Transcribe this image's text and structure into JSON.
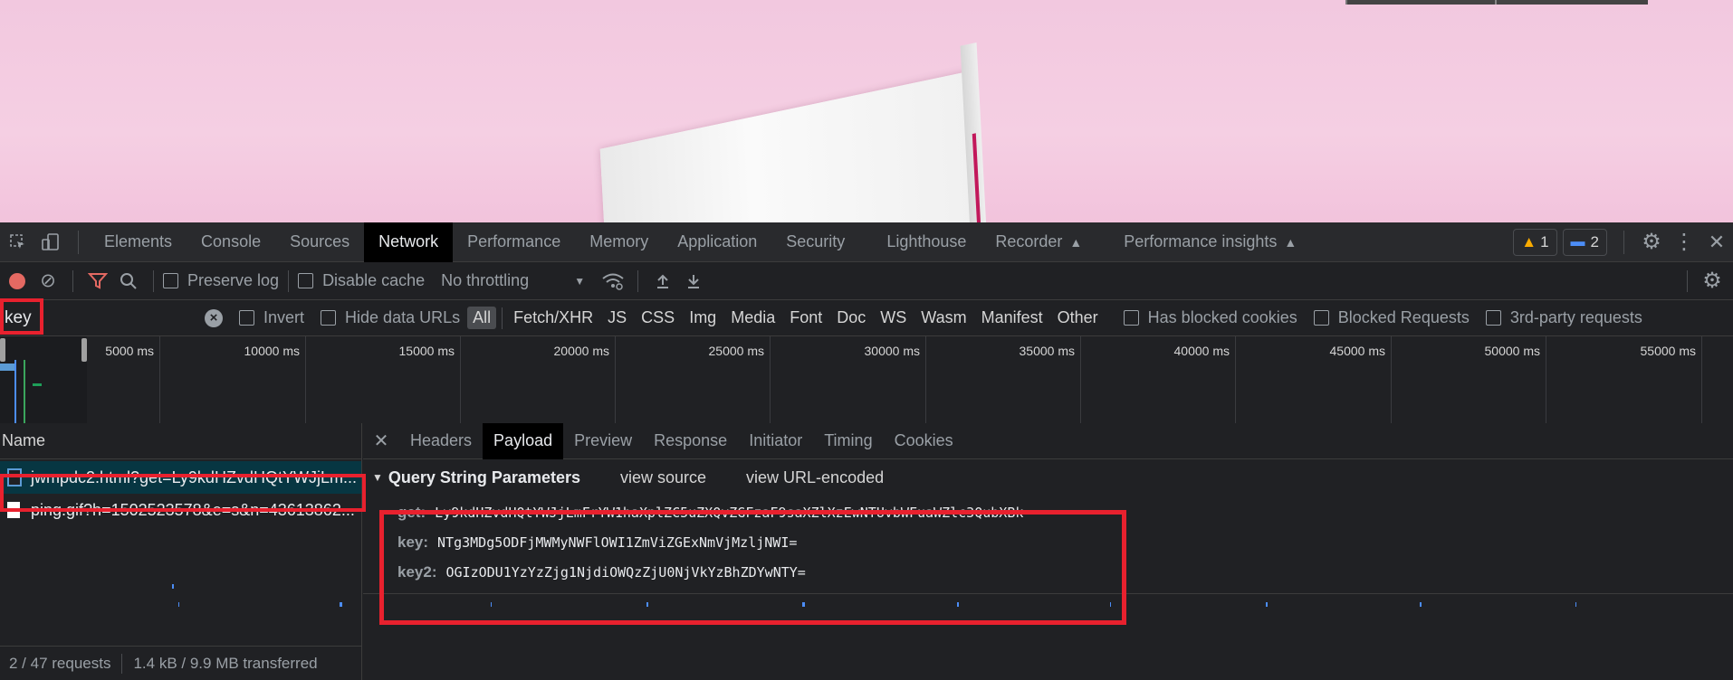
{
  "devtools": {
    "tabs": [
      "Elements",
      "Console",
      "Sources",
      "Network",
      "Performance",
      "Memory",
      "Application",
      "Security",
      "Lighthouse",
      "Recorder",
      "Performance insights"
    ],
    "active_tab": "Network",
    "warnings_count": "1",
    "messages_count": "2"
  },
  "toolbar": {
    "preserve_log": "Preserve log",
    "disable_cache": "Disable cache",
    "throttling": "No throttling"
  },
  "filter": {
    "value": "key",
    "invert": "Invert",
    "hide_data_urls": "Hide data URLs",
    "types": [
      "All",
      "Fetch/XHR",
      "JS",
      "CSS",
      "Img",
      "Media",
      "Font",
      "Doc",
      "WS",
      "Wasm",
      "Manifest",
      "Other"
    ],
    "has_blocked_cookies": "Has blocked cookies",
    "blocked_requests": "Blocked Requests",
    "third_party": "3rd-party requests"
  },
  "timeline": {
    "ticks": [
      "5000 ms",
      "10000 ms",
      "15000 ms",
      "20000 ms",
      "25000 ms",
      "30000 ms",
      "35000 ms",
      "40000 ms",
      "45000 ms",
      "50000 ms",
      "55000 ms"
    ]
  },
  "requests": {
    "header": "Name",
    "items": [
      "jwmpdc2.html?get=Ly9kdHZvdHQtYWJjLm...",
      "ping.gif?h=1502523578&e=s&n=43613862..."
    ],
    "status": "2 / 47 requests",
    "transferred": "1.4 kB / 9.9 MB transferred"
  },
  "detail": {
    "tabs": [
      "Headers",
      "Payload",
      "Preview",
      "Response",
      "Initiator",
      "Timing",
      "Cookies"
    ],
    "active_tab": "Payload",
    "section_title": "Query String Parameters",
    "view_source": "view source",
    "view_url_encoded": "view URL-encoded",
    "params": [
      {
        "key": "get:",
        "value": "Ly9kdHZvdHQtYWJjLmFrYW1haXplZC5uZXQvZGFzaF9saXZlXzEwNTUvbWFuaWZlc3QubXBk"
      },
      {
        "key": "key:",
        "value": "NTg3MDg5ODFjMWMyNWFlOWI1ZmViZGExNmVjMzljNWI="
      },
      {
        "key": "key2:",
        "value": "OGIzODU1YzYzZjg1NjdiOWQzZjU0NjVkYzBhZDYwNTY="
      }
    ]
  },
  "colors": {
    "highlight": "#e8212e",
    "page_bg": "#f5cfe3",
    "devtools_bg": "#202124"
  }
}
